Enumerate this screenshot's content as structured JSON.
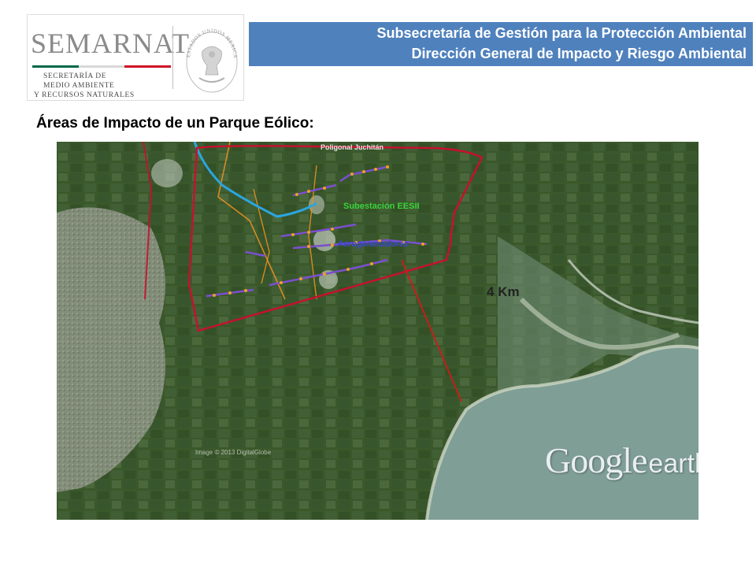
{
  "header": {
    "logo": {
      "name": "SEMARNAT",
      "subtitle_lines": [
        "SECRETARÍA DE",
        "MEDIO AMBIENTE",
        "Y RECURSOS NATURALES"
      ],
      "seal_text": "ESTADOS UNIDOS MEXICANOS",
      "colors": [
        "#006847",
        "#ffffff",
        "#ce1126"
      ]
    },
    "banner": {
      "line1": "Subsecretaría de Gestión para la Protección Ambiental",
      "line2": "Dirección General de Impacto y Riesgo Ambiental",
      "color": "#4f81bd"
    }
  },
  "slide": {
    "title": "Áreas de Impacto de un Parque Eólico:"
  },
  "map": {
    "labels": {
      "polygon": "Poligonal Juchitán",
      "substation": "Subestación EESII",
      "turbines": "Aerogeneradores",
      "distance": "4 Km",
      "image_credit": "Image © 2013 DigitalGlobe"
    },
    "watermark": {
      "part1": "Google",
      "part2": "earth"
    },
    "colors": {
      "polygon_outline": "#c8102e",
      "distance_line": "#d11a1a",
      "turbine_line": "#7a4fd0",
      "turbine_dot": "#f0a020",
      "road": "#e89020",
      "river": "#2aa6e0",
      "substation_label": "#39d23a",
      "turbines_label": "#3a46d8",
      "sea": "#7f9e96",
      "land": "#3c5a2c"
    }
  }
}
